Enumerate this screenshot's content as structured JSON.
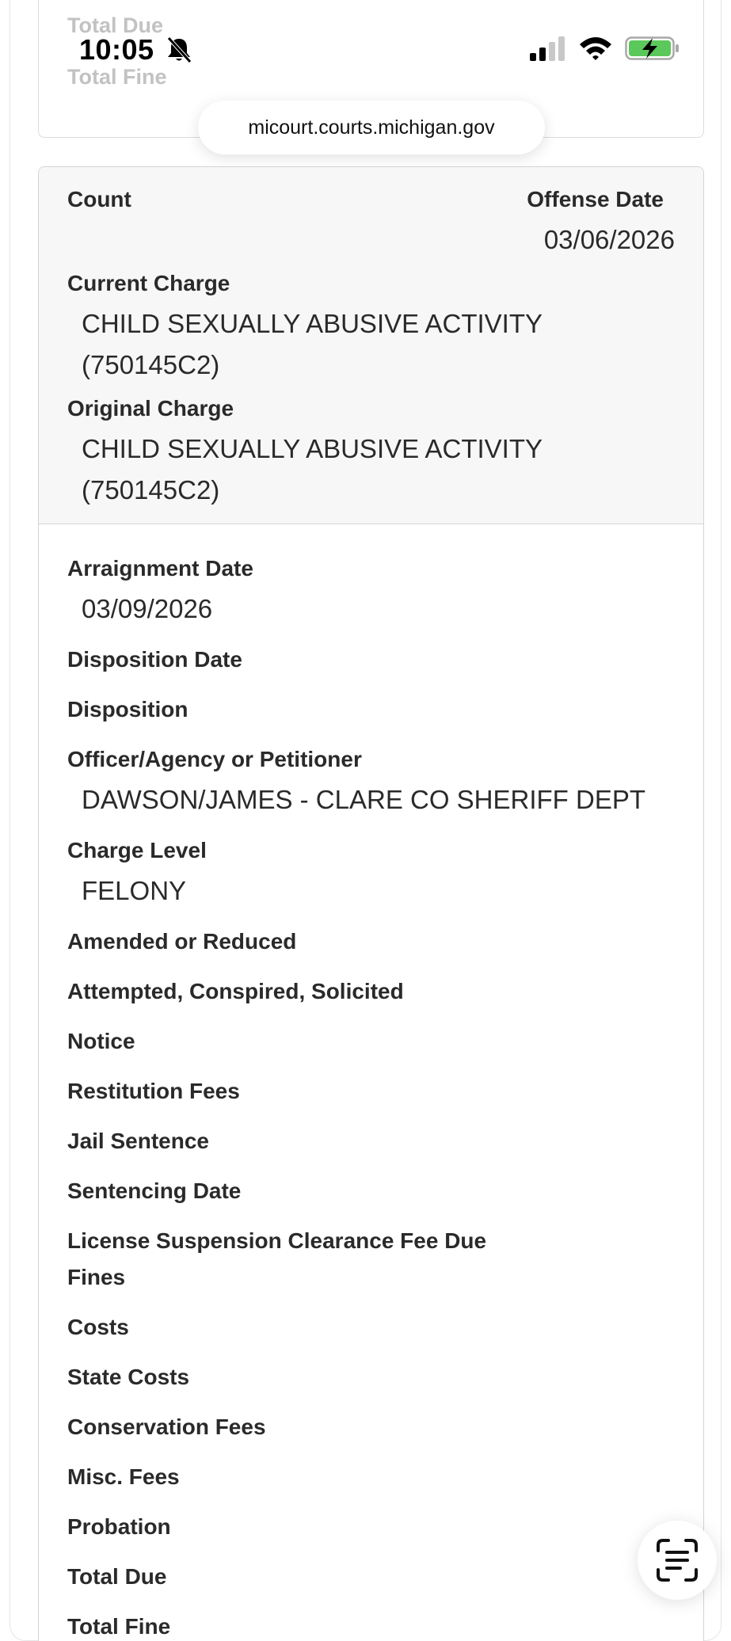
{
  "status_bar": {
    "time": "10:05",
    "icons": [
      "bell-slash-icon",
      "cellular-signal-icon",
      "wifi-icon",
      "battery-charging-icon"
    ],
    "battery_color": "#5ac85a"
  },
  "browser": {
    "url": "micourt.courts.michigan.gov",
    "text_scan_icon": "live-text-icon"
  },
  "previous_card": {
    "total_due_label": "Total Due",
    "total_fine_label": "Total Fine"
  },
  "charge": {
    "count_label": "Count",
    "offense_date_label": "Offense Date",
    "offense_date": "03/06/2026",
    "current_charge_label": "Current Charge",
    "current_charge_line1": "CHILD SEXUALLY ABUSIVE ACTIVITY",
    "current_charge_line2": "(750145C2)",
    "original_charge_label": "Original Charge",
    "original_charge_line1": "CHILD SEXUALLY ABUSIVE ACTIVITY",
    "original_charge_line2": "(750145C2)"
  },
  "details": {
    "arraignment_date_label": "Arraignment Date",
    "arraignment_date": "03/09/2026",
    "disposition_date_label": "Disposition Date",
    "disposition_label": "Disposition",
    "officer_label": "Officer/Agency or Petitioner",
    "officer_value": "DAWSON/JAMES - CLARE CO SHERIFF DEPT",
    "charge_level_label": "Charge Level",
    "charge_level_value": "FELONY",
    "amended_label": "Amended or Reduced",
    "attempted_label": "Attempted, Conspired, Solicited",
    "notice_label": "Notice",
    "restitution_label": "Restitution Fees",
    "jail_label": "Jail Sentence",
    "sentencing_label": "Sentencing Date",
    "license_fee_label": "License Suspension Clearance Fee Due",
    "fines_label": "Fines",
    "costs_label": "Costs",
    "state_costs_label": "State Costs",
    "conservation_label": "Conservation Fees",
    "misc_label": "Misc. Fees",
    "probation_label": "Probation",
    "total_due_label": "Total Due",
    "total_fine_label": "Total Fine"
  }
}
